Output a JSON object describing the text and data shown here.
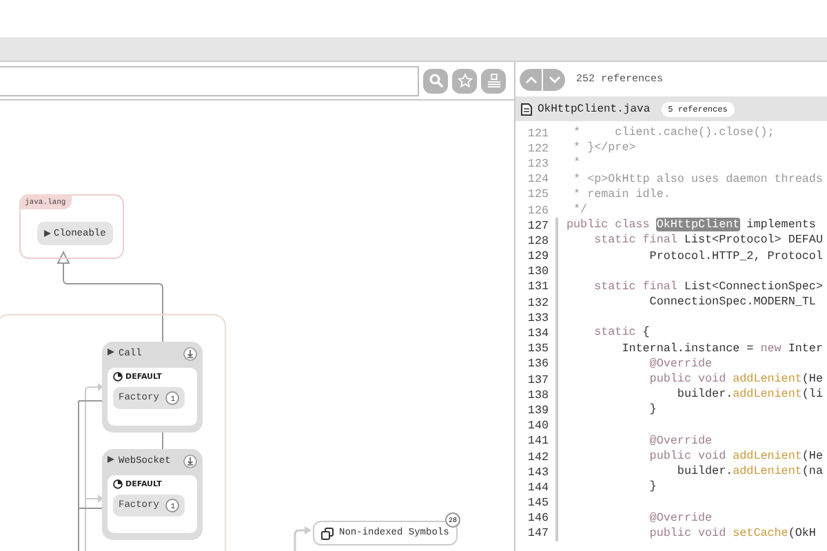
{
  "diagram": {
    "package": {
      "label": "java.lang",
      "items": [
        {
          "label": "Cloneable"
        }
      ]
    },
    "classes": [
      {
        "name": "Call",
        "tag": "DEFAULT",
        "members": [
          {
            "label": "Factory",
            "count": "1"
          }
        ]
      },
      {
        "name": "WebSocket",
        "tag": "DEFAULT",
        "members": [
          {
            "label": "Factory",
            "count": "1"
          }
        ]
      }
    ],
    "symbols": {
      "label": "Non-indexed Symbols",
      "count": "28"
    }
  },
  "code_pane": {
    "references": "252 references",
    "file": {
      "name": "OkHttpClient.java",
      "badge": "5 references"
    },
    "lines": [
      {
        "number": "121",
        "scope": false,
        "parts": [
          {
            "kind": "comment",
            "text": " *     client.cache().close();"
          }
        ]
      },
      {
        "number": "122",
        "scope": false,
        "parts": [
          {
            "kind": "comment",
            "text": " * }</pre>"
          }
        ]
      },
      {
        "number": "123",
        "scope": false,
        "parts": [
          {
            "kind": "comment",
            "text": " *"
          }
        ]
      },
      {
        "number": "124",
        "scope": false,
        "parts": [
          {
            "kind": "comment",
            "text": " * <p>OkHttp also uses daemon threads"
          }
        ]
      },
      {
        "number": "125",
        "scope": false,
        "parts": [
          {
            "kind": "comment",
            "text": " * remain idle."
          }
        ]
      },
      {
        "number": "126",
        "scope": false,
        "parts": [
          {
            "kind": "comment",
            "text": " */"
          }
        ]
      },
      {
        "number": "127",
        "scope": true,
        "parts": [
          {
            "kind": "keyword",
            "text": "public class "
          },
          {
            "kind": "match",
            "text": "OkHttpClient"
          },
          {
            "kind": "plain",
            "text": " implements"
          }
        ]
      },
      {
        "number": "128",
        "scope": true,
        "parts": [
          {
            "kind": "keyword",
            "text": "    static final "
          },
          {
            "kind": "plain",
            "text": "List<Protocol> DEFAU"
          }
        ]
      },
      {
        "number": "129",
        "scope": true,
        "parts": [
          {
            "kind": "plain",
            "text": "            Protocol.HTTP_2, Protocol"
          }
        ]
      },
      {
        "number": "130",
        "scope": true
      },
      {
        "number": "131",
        "scope": true,
        "parts": [
          {
            "kind": "keyword",
            "text": "    static final "
          },
          {
            "kind": "plain",
            "text": "List<ConnectionSpec>"
          }
        ]
      },
      {
        "number": "132",
        "scope": true,
        "parts": [
          {
            "kind": "plain",
            "text": "            ConnectionSpec.MODERN_TL"
          }
        ]
      },
      {
        "number": "133",
        "scope": true
      },
      {
        "number": "134",
        "scope": true,
        "parts": [
          {
            "kind": "keyword",
            "text": "    static "
          },
          {
            "kind": "plain",
            "text": "{"
          }
        ]
      },
      {
        "number": "135",
        "scope": true,
        "parts": [
          {
            "kind": "plain",
            "text": "        Internal.instance = "
          },
          {
            "kind": "keyword",
            "text": "new "
          },
          {
            "kind": "plain",
            "text": "Inter"
          }
        ]
      },
      {
        "number": "136",
        "scope": true,
        "parts": [
          {
            "kind": "keyword",
            "text": "            @Override"
          }
        ]
      },
      {
        "number": "137",
        "scope": true,
        "parts": [
          {
            "kind": "keyword",
            "text": "            public void "
          },
          {
            "kind": "method",
            "text": "addLenient"
          },
          {
            "kind": "plain",
            "text": "(He"
          }
        ]
      },
      {
        "number": "138",
        "scope": true,
        "parts": [
          {
            "kind": "plain",
            "text": "                builder."
          },
          {
            "kind": "method",
            "text": "addLenient"
          },
          {
            "kind": "plain",
            "text": "(li"
          }
        ]
      },
      {
        "number": "139",
        "scope": true,
        "parts": [
          {
            "kind": "plain",
            "text": "            }"
          }
        ]
      },
      {
        "number": "140",
        "scope": true
      },
      {
        "number": "141",
        "scope": true,
        "parts": [
          {
            "kind": "keyword",
            "text": "            @Override"
          }
        ]
      },
      {
        "number": "142",
        "scope": true,
        "parts": [
          {
            "kind": "keyword",
            "text": "            public void "
          },
          {
            "kind": "method",
            "text": "addLenient"
          },
          {
            "kind": "plain",
            "text": "(He"
          }
        ]
      },
      {
        "number": "143",
        "scope": true,
        "parts": [
          {
            "kind": "plain",
            "text": "                builder."
          },
          {
            "kind": "method",
            "text": "addLenient"
          },
          {
            "kind": "plain",
            "text": "(na"
          }
        ]
      },
      {
        "number": "144",
        "scope": true,
        "parts": [
          {
            "kind": "plain",
            "text": "            }"
          }
        ]
      },
      {
        "number": "145",
        "scope": true
      },
      {
        "number": "146",
        "scope": true,
        "parts": [
          {
            "kind": "keyword",
            "text": "            @Override"
          }
        ]
      },
      {
        "number": "147",
        "scope": true,
        "parts": [
          {
            "kind": "keyword",
            "text": "            public void "
          },
          {
            "kind": "method",
            "text": "setCache"
          },
          {
            "kind": "plain",
            "text": "(OkH"
          }
        ]
      }
    ]
  }
}
